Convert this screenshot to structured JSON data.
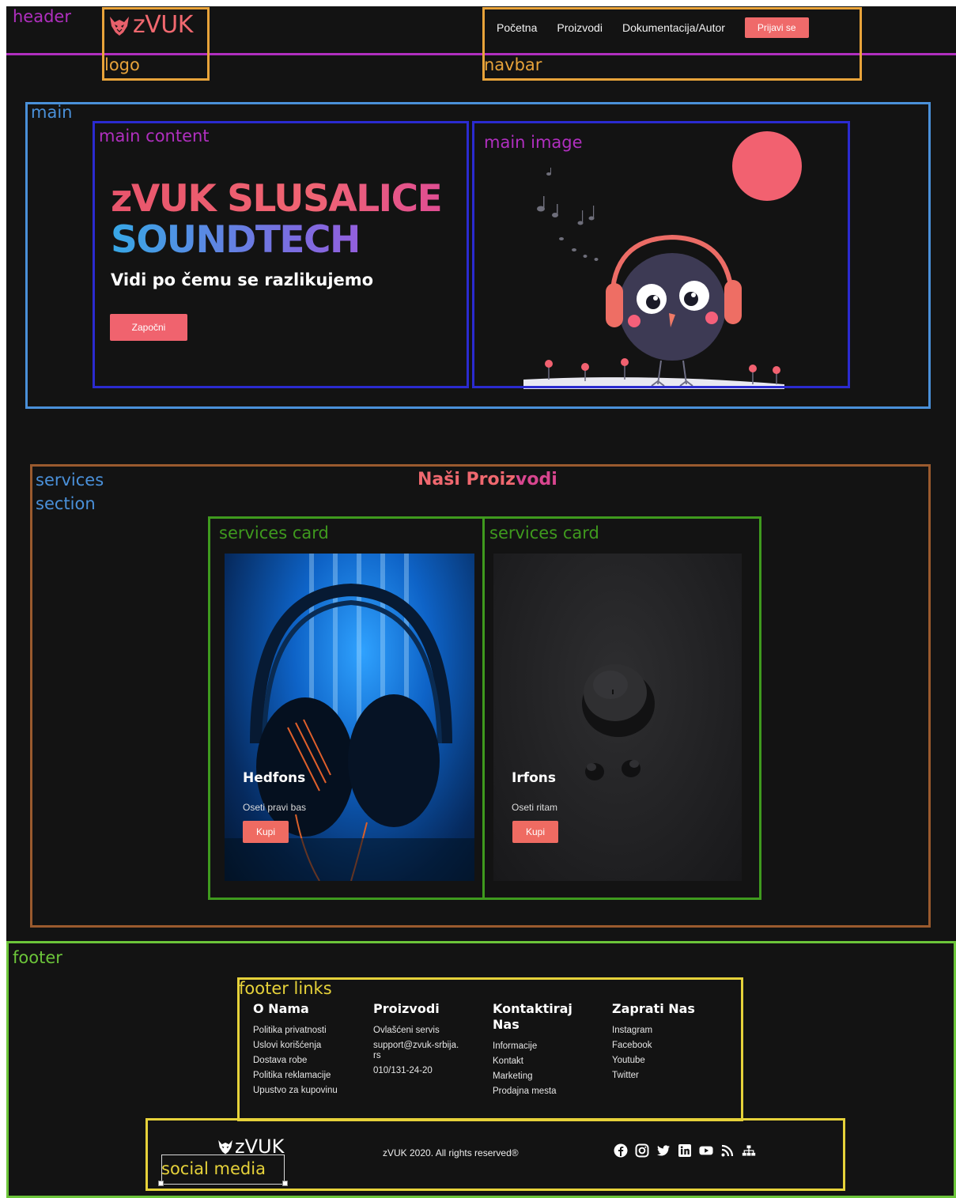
{
  "header": {
    "logo_text": "zVUK",
    "nav": [
      "Početna",
      "Proizvodi",
      "Dokumentacija/Autor"
    ],
    "login_label": "Prijavi se"
  },
  "hero": {
    "title_line1": "zVUK SLUSALICE",
    "title_line2": "SOUNDTECH",
    "subtitle": "Vidi po čemu se razlikujemo",
    "button_label": "Započni"
  },
  "services": {
    "title_part1": "Naši Proiz",
    "title_part2": "vodi",
    "cards": [
      {
        "title": "Hedfons",
        "subtitle": "Oseti pravi bas",
        "button": "Kupi"
      },
      {
        "title": "Irfons",
        "subtitle": "Oseti ritam",
        "button": "Kupi"
      }
    ]
  },
  "footer": {
    "columns": [
      {
        "title": "O Nama",
        "links": [
          "Politika privatnosti",
          "Uslovi korišćenja",
          "Dostava robe",
          "Politika reklamacije",
          "Upustvo za kupovinu"
        ]
      },
      {
        "title": "Proizvodi",
        "links": [
          "Ovlašćeni servis",
          "support@zvuk-srbija.rs",
          "010/131-24-20"
        ]
      },
      {
        "title": "Kontaktiraj Nas",
        "links": [
          "Informacije",
          "Kontakt",
          "Marketing",
          "Prodajna mesta"
        ]
      },
      {
        "title": "Zaprati Nas",
        "links": [
          "Instagram",
          "Facebook",
          "Youtube",
          "Twitter"
        ]
      }
    ],
    "logo_text": "zVUK",
    "copyright": "zVUK 2020. All rights reserved®",
    "social_icons": [
      "facebook-icon",
      "instagram-icon",
      "twitter-icon",
      "linkedin-icon",
      "youtube-icon",
      "rss-icon",
      "sitemap-icon"
    ]
  },
  "annotations": {
    "header": "header",
    "logo": "logo",
    "navbar": "navbar",
    "main": "main",
    "main_content": "main content",
    "main_image": "main image",
    "services_section_1": "services",
    "services_section_2": "section",
    "services_card_1": "services card",
    "services_card_2": "services card",
    "footer": "footer",
    "footer_links": "footer links",
    "social_media": "social media"
  },
  "colors": {
    "background": "#131313",
    "accent": "#f0636e",
    "ann_header": "#b02fbf",
    "ann_logo": "#e8a33a",
    "ann_main": "#4a90d9",
    "ann_main_inner": "#2b2bd0",
    "ann_services": "#9a5a2e",
    "ann_card": "#3f9a1e",
    "ann_footer": "#6cc53a",
    "ann_footer_links": "#e6d23a"
  }
}
